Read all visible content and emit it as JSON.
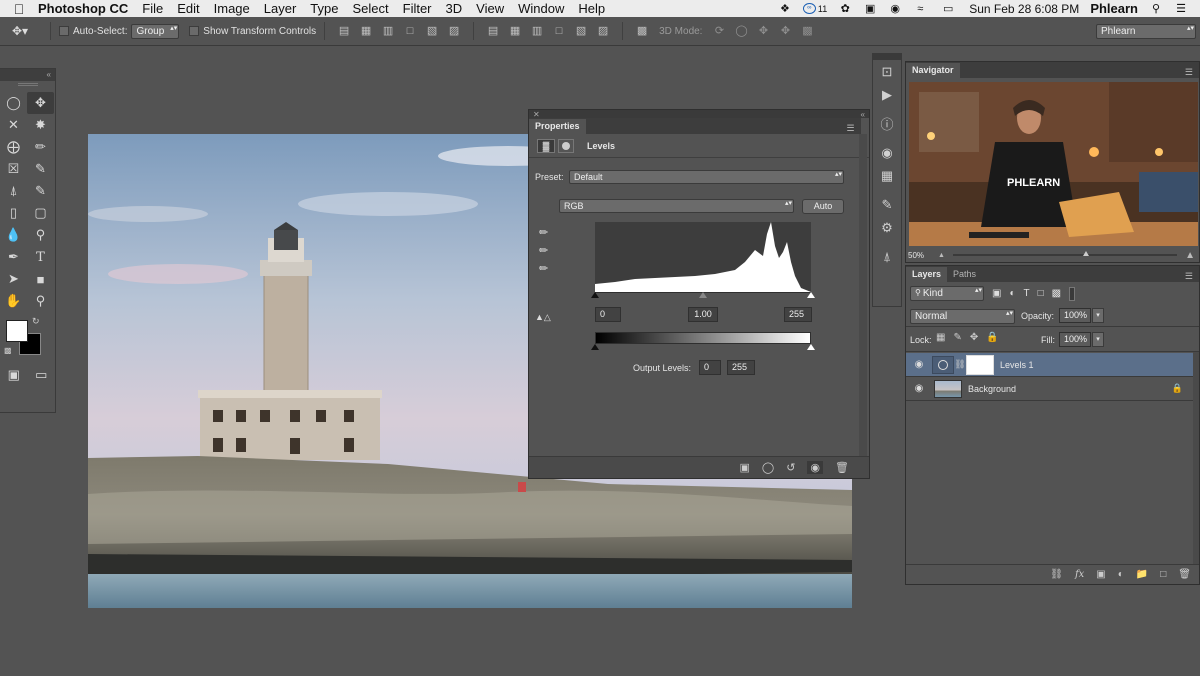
{
  "menubar": {
    "app_name": "Photoshop CC",
    "items": [
      "File",
      "Edit",
      "Image",
      "Layer",
      "Type",
      "Select",
      "Filter",
      "3D",
      "View",
      "Window",
      "Help"
    ],
    "badge": "11",
    "clock": "Sun Feb 28  6:08 PM",
    "user": "Phlearn"
  },
  "options": {
    "auto_select_label": "Auto-Select:",
    "auto_select_value": "Group",
    "show_transform_label": "Show Transform Controls",
    "mode_3d_label": "3D Mode:",
    "workspace": "Phlearn"
  },
  "properties": {
    "tab": "Properties",
    "adjustment_title": "Levels",
    "preset_label": "Preset:",
    "preset_value": "Default",
    "channel_value": "RGB",
    "auto_label": "Auto",
    "input_black": "0",
    "input_gamma": "1.00",
    "input_white": "255",
    "output_label": "Output Levels:",
    "output_black": "0",
    "output_white": "255"
  },
  "navigator": {
    "tab": "Navigator",
    "zoom": "50%",
    "shirt_text": "PHLEARN"
  },
  "layers": {
    "tabs": [
      "Layers",
      "Paths"
    ],
    "filter_value": "Kind",
    "blend_mode": "Normal",
    "opacity_label": "Opacity:",
    "opacity_value": "100%",
    "lock_label": "Lock:",
    "fill_label": "Fill:",
    "fill_value": "100%",
    "rows": [
      {
        "name": "Levels 1"
      },
      {
        "name": "Background"
      }
    ]
  },
  "colors": {
    "ui_bg": "#535353",
    "panel_dark": "#3d3d3d",
    "selected_layer": "#5b6f8a",
    "menubar": "#ececec"
  }
}
